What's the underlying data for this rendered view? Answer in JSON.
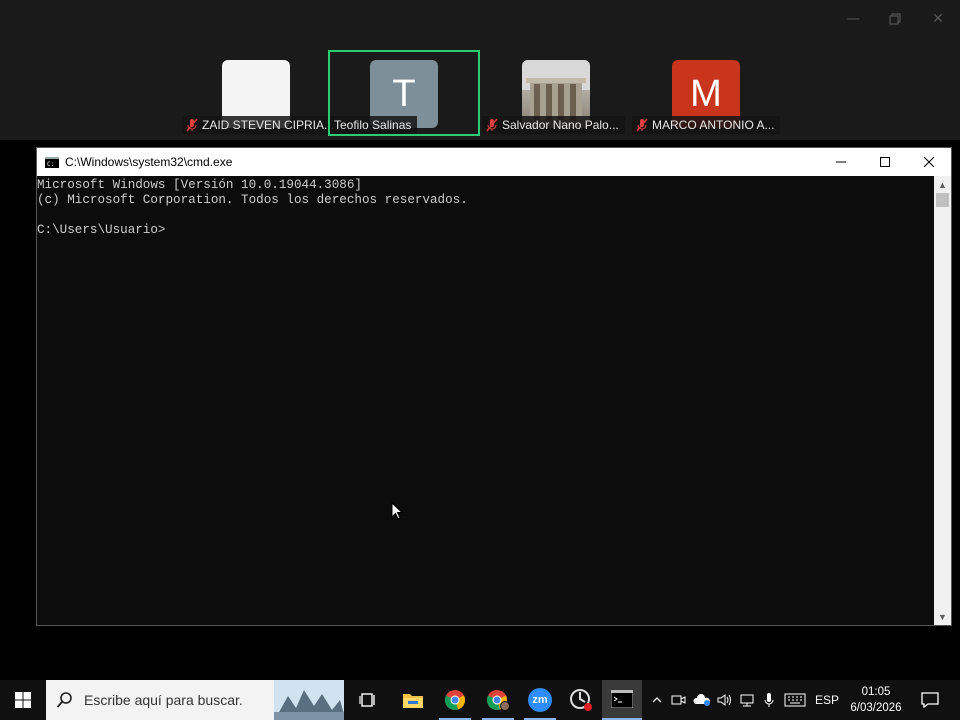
{
  "zoom": {
    "participants": [
      {
        "name": "ZAID STEVEN CIPRIA...",
        "muted": true,
        "avatar_type": "blank"
      },
      {
        "name": "Teofilo Salinas",
        "muted": false,
        "avatar_letter": "T",
        "avatar_color": "#7d8f99",
        "active_speaker": true
      },
      {
        "name": "Salvador Nano Palo...",
        "muted": true,
        "avatar_type": "photo"
      },
      {
        "name": "MARCO ANTONIO A...",
        "muted": true,
        "avatar_letter": "M",
        "avatar_color": "#c8341c"
      }
    ],
    "window_controls": [
      "minimize-icon",
      "restore-icon",
      "close-icon"
    ],
    "active_border_color": "#2ecc71"
  },
  "cmd": {
    "title": "C:\\Windows\\system32\\cmd.exe",
    "lines": [
      "Microsoft Windows [Versión 10.0.19044.3086]",
      "(c) Microsoft Corporation. Todos los derechos reservados.",
      "",
      "C:\\Users\\Usuario>"
    ]
  },
  "taskbar": {
    "search_placeholder": "Escribe aquí para buscar.",
    "apps": [
      "task-view-icon",
      "file-explorer-icon",
      "chrome-icon",
      "chrome-profile-icon",
      "zoom-icon",
      "screen-recorder-icon",
      "cmd-icon"
    ],
    "zoom_label": "zm",
    "language": "ESP",
    "time": "01:05",
    "date": "6/03/2026"
  }
}
